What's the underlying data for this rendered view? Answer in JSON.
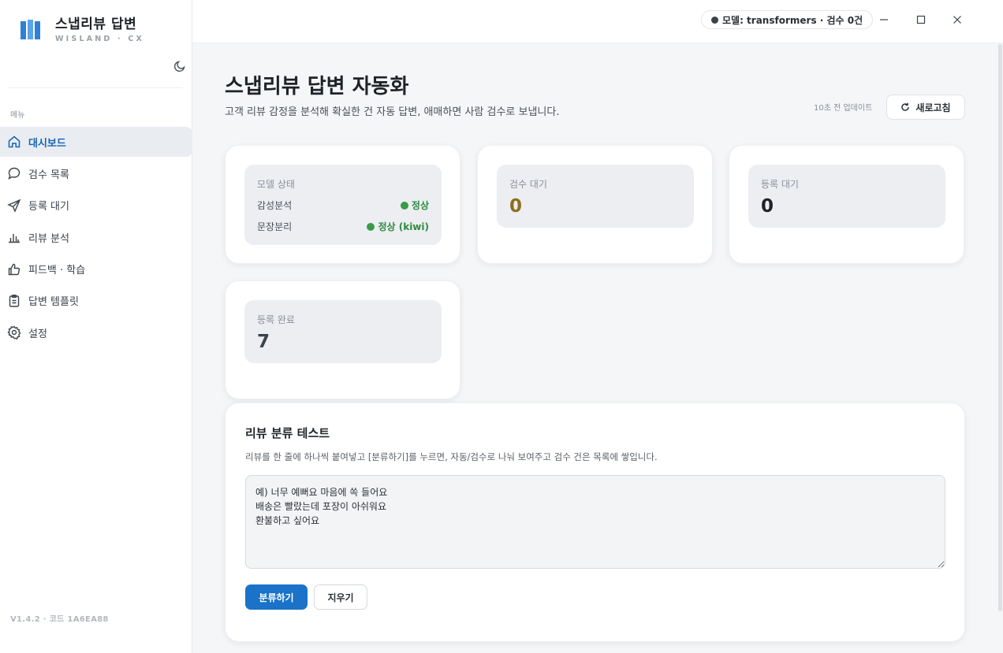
{
  "brand": {
    "title": "스냅리뷰 답변",
    "subtitle": "WISLAND · CX"
  },
  "sidebar": {
    "menu_label": "메뉴",
    "items": [
      {
        "label": "대시보드",
        "icon": "home-icon",
        "active": true
      },
      {
        "label": "검수 목록",
        "icon": "chat-bubble-icon"
      },
      {
        "label": "등록 대기",
        "icon": "send-icon"
      },
      {
        "label": "리뷰 분석",
        "icon": "bar-chart-icon"
      },
      {
        "label": "피드백 · 학습",
        "icon": "thumbs-up-icon"
      },
      {
        "label": "답변 템플릿",
        "icon": "clipboard-icon"
      },
      {
        "label": "설정",
        "icon": "gear-icon"
      }
    ],
    "version": "V1.4.2 · 코드 1A6EA88"
  },
  "topbar": {
    "model_status": "모델: transformers · 검수 0건"
  },
  "header": {
    "title": "스냅리뷰 답변 자동화",
    "description": "고객 리뷰 감정을 분석해 확실한 건 자동 답변, 애매하면 사람 검수로 보냅니다.",
    "updated": "10초 전 업데이트",
    "refresh_label": "새로고침"
  },
  "model_card": {
    "title": "모델 상태",
    "rows": [
      {
        "label": "감성분석",
        "status": "정상"
      },
      {
        "label": "문장분리",
        "status": "정상 (kiwi)"
      }
    ]
  },
  "stats": {
    "review_wait": {
      "label": "검수 대기",
      "value": "0",
      "color": "#8d6e1f"
    },
    "register_wait": {
      "label": "등록 대기",
      "value": "0",
      "color": "#1f2328"
    },
    "registered": {
      "label": "등록 완료",
      "value": "7",
      "color": "#3c4249"
    }
  },
  "test": {
    "title": "리뷰 분류 테스트",
    "description": "리뷰를 한 줄에 하나씩 붙여넣고 [분류하기]를 누르면, 자동/검수로 나눠 보여주고 검수 건은 목록에 쌓입니다.",
    "input_value": "예) 너무 예뻐요 마음에 쏙 들어요\n배송은 빨랐는데 포장이 아쉬워요\n환불하고 싶어요",
    "classify_label": "분류하기",
    "clear_label": "지우기"
  },
  "colors": {
    "accent": "#1a73c8",
    "ok": "#2e8b3e"
  }
}
